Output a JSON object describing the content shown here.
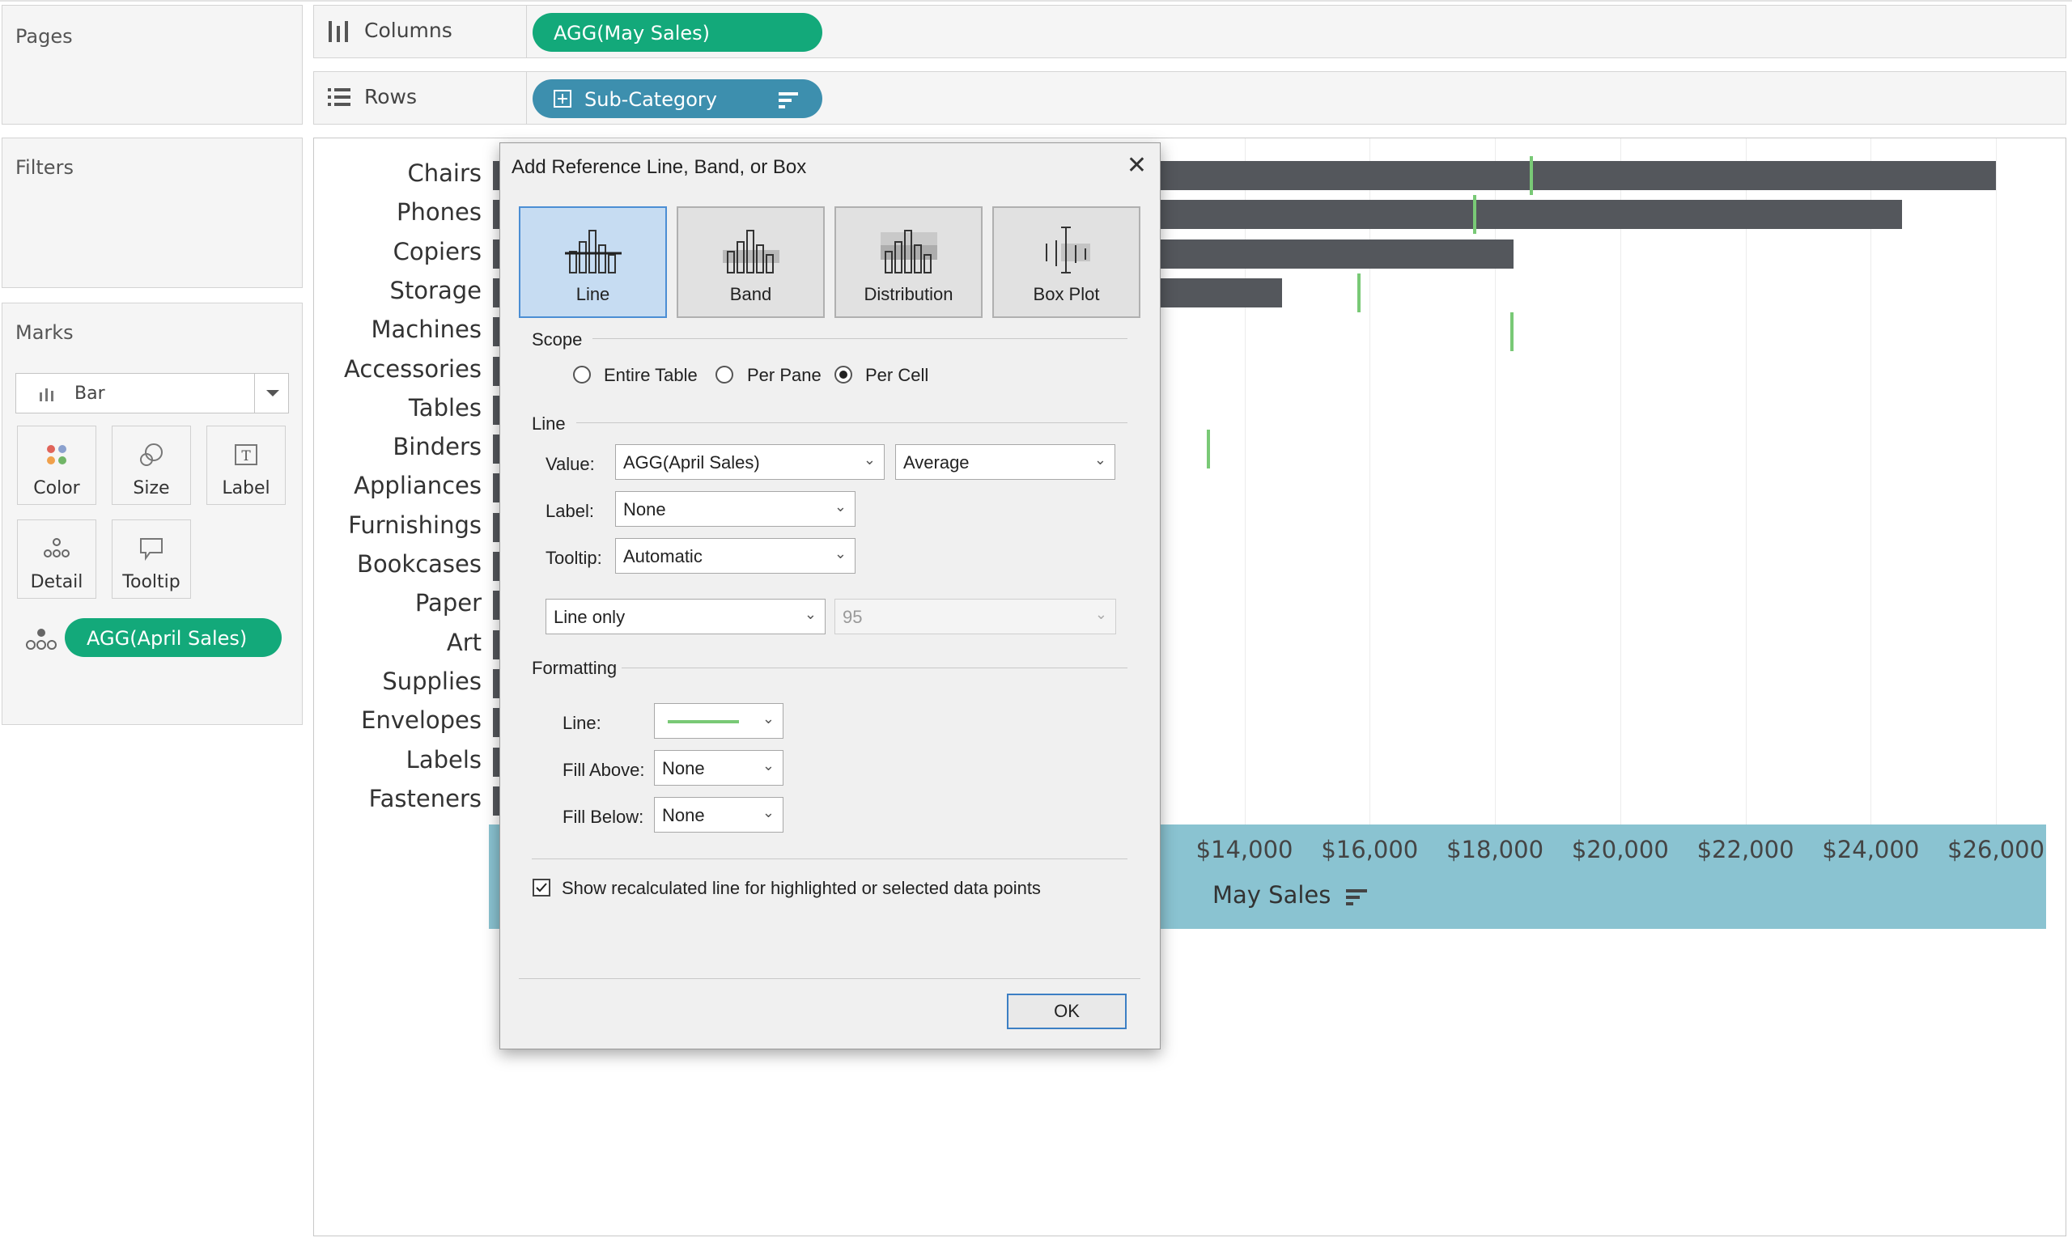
{
  "left_panels": {
    "pages_title": "Pages",
    "filters_title": "Filters",
    "marks_title": "Marks",
    "mark_type": "Bar",
    "mark_cards": [
      {
        "label": "Color"
      },
      {
        "label": "Size"
      },
      {
        "label": "Label"
      },
      {
        "label": "Detail"
      },
      {
        "label": "Tooltip"
      }
    ],
    "detail_pill": "AGG(April Sales)"
  },
  "shelves": {
    "columns_label": "Columns",
    "columns_pill": "AGG(May Sales)",
    "rows_label": "Rows",
    "rows_pill": "Sub-Category"
  },
  "chart_data": {
    "type": "bar",
    "categories": [
      "Chairs",
      "Phones",
      "Copiers",
      "Storage",
      "Machines",
      "Accessories",
      "Tables",
      "Binders",
      "Appliances",
      "Furnishings",
      "Bookcases",
      "Paper",
      "Art",
      "Supplies",
      "Envelopes",
      "Labels",
      "Fasteners"
    ],
    "series": [
      {
        "values": [
          26000,
          24500,
          18300,
          14600,
          null,
          null,
          null,
          null,
          null,
          null,
          null,
          null,
          null,
          null,
          null,
          null,
          null
        ]
      }
    ],
    "reference_lines": [
      18550,
      17650,
      null,
      15800,
      18250,
      null,
      null,
      13400,
      null,
      null,
      null,
      null,
      null,
      null,
      null,
      null,
      null
    ],
    "xticks": [
      "$14,000",
      "$16,000",
      "$18,000",
      "$20,000",
      "$22,000",
      "$24,000",
      "$26,000"
    ],
    "xtick_values": [
      14000,
      16000,
      18000,
      20000,
      22000,
      24000,
      26000
    ],
    "xlabel": "May Sales",
    "xlim": [
      2000,
      26800
    ],
    "bar_color": "#54575c",
    "ref_line_color": "#79c976"
  },
  "dialog": {
    "title": "Add Reference Line, Band, or Box",
    "close_glyph": "✕",
    "types": [
      {
        "label": "Line",
        "selected": true
      },
      {
        "label": "Band"
      },
      {
        "label": "Distribution"
      },
      {
        "label": "Box Plot"
      }
    ],
    "scope_title": "Scope",
    "scope_options": [
      "Entire Table",
      "Per Pane",
      "Per Cell"
    ],
    "scope_selected": "Per Cell",
    "line_title": "Line",
    "value_label": "Value:",
    "value_field": "AGG(April Sales)",
    "value_agg": "Average",
    "label_label": "Label:",
    "label_value": "None",
    "tooltip_label": "Tooltip:",
    "tooltip_value": "Automatic",
    "line_mode": "Line only",
    "confidence": "95",
    "formatting_title": "Formatting",
    "fmt_line_label": "Line:",
    "fill_above_label": "Fill Above:",
    "fill_above_value": "None",
    "fill_below_label": "Fill Below:",
    "fill_below_value": "None",
    "recalc_label": "Show recalculated line for highlighted or selected data points",
    "recalc_checked": true,
    "ok_label": "OK"
  }
}
